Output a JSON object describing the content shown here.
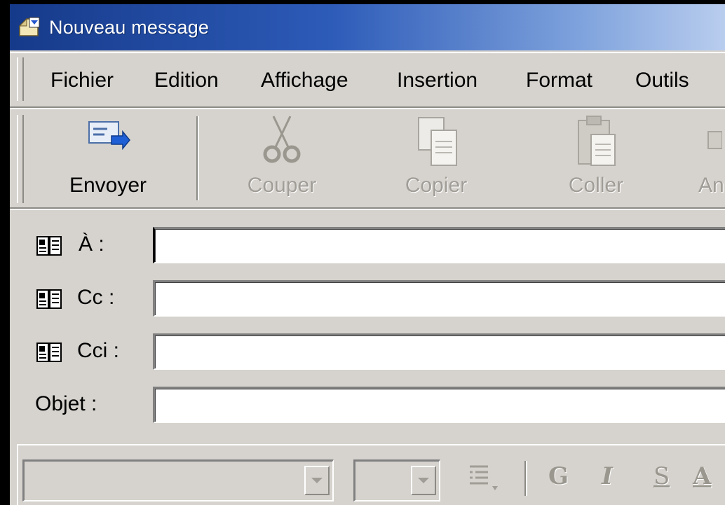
{
  "window": {
    "title": "Nouveau message"
  },
  "menu": {
    "items": [
      "Fichier",
      "Edition",
      "Affichage",
      "Insertion",
      "Format",
      "Outils"
    ]
  },
  "toolbar": {
    "send_label": "Envoyer",
    "cut_label": "Couper",
    "copy_label": "Copier",
    "paste_label": "Coller",
    "partial_label": "An"
  },
  "fields": {
    "to_label": "À :",
    "cc_label": "Cc :",
    "bcc_label": "Cci :",
    "subject_label": "Objet :",
    "to_value": "",
    "cc_value": "",
    "bcc_value": "",
    "subject_value": ""
  },
  "formatbar": {
    "bold": "G",
    "italic": "I",
    "underline": "S",
    "font_color": "A"
  },
  "colors": {
    "titlebar_start": "#163a8a",
    "titlebar_end": "#b9cdee",
    "chrome": "#d6d3ce",
    "disabled_text": "#a09d97"
  },
  "icons": [
    "app-compose-icon",
    "send-icon",
    "scissors-icon",
    "copy-icon",
    "clipboard-icon",
    "address-book-icon",
    "dropdown-arrow-icon",
    "list-icon"
  ]
}
